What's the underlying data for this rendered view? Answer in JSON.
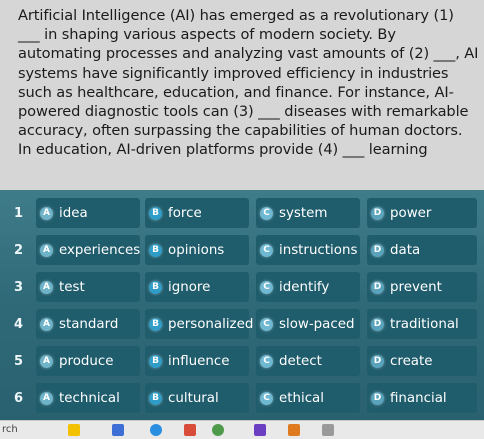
{
  "passage": {
    "lines": [
      "Artificial Intelligence (AI) has emerged as a revolutionary (1)",
      "___ in shaping various aspects of modern society. By",
      "automating processes and analyzing vast amounts of (2) ___, AI",
      "systems have significantly improved efficiency in industries",
      "such as healthcare, education, and finance. For instance, AI-",
      "powered diagnostic tools can (3) ___ diseases with remarkable",
      "accuracy, often surpassing the capabilities of human doctors.",
      "In education, AI-driven platforms provide (4) ___ learning"
    ]
  },
  "questions": [
    {
      "num": "1",
      "options": [
        {
          "letter": "A",
          "text": "idea"
        },
        {
          "letter": "B",
          "text": "force"
        },
        {
          "letter": "C",
          "text": "system"
        },
        {
          "letter": "D",
          "text": "power"
        }
      ]
    },
    {
      "num": "2",
      "options": [
        {
          "letter": "A",
          "text": "experiences"
        },
        {
          "letter": "B",
          "text": "opinions"
        },
        {
          "letter": "C",
          "text": "instructions"
        },
        {
          "letter": "D",
          "text": "data"
        }
      ]
    },
    {
      "num": "3",
      "options": [
        {
          "letter": "A",
          "text": "test"
        },
        {
          "letter": "B",
          "text": "ignore"
        },
        {
          "letter": "C",
          "text": "identify"
        },
        {
          "letter": "D",
          "text": "prevent"
        }
      ]
    },
    {
      "num": "4",
      "options": [
        {
          "letter": "A",
          "text": "standard"
        },
        {
          "letter": "B",
          "text": "personalized"
        },
        {
          "letter": "C",
          "text": "slow-paced"
        },
        {
          "letter": "D",
          "text": "traditional"
        }
      ]
    },
    {
      "num": "5",
      "options": [
        {
          "letter": "A",
          "text": "produce"
        },
        {
          "letter": "B",
          "text": "influence"
        },
        {
          "letter": "C",
          "text": "detect"
        },
        {
          "letter": "D",
          "text": "create"
        }
      ]
    },
    {
      "num": "6",
      "options": [
        {
          "letter": "A",
          "text": "technical"
        },
        {
          "letter": "B",
          "text": "cultural"
        },
        {
          "letter": "C",
          "text": "ethical"
        },
        {
          "letter": "D",
          "text": "financial"
        }
      ]
    }
  ],
  "taskbar": {
    "search_text": "rch",
    "icons": [
      "star-icon",
      "app-icon-1",
      "browser-icon",
      "app-icon-2",
      "app-icon-3",
      "app-icon-4",
      "app-icon-5",
      "app-icon-6"
    ],
    "icon_colors": [
      "#f2c200",
      "#3d6fd6",
      "#2a8fe0",
      "#d94c3a",
      "#4f9a4a",
      "#6b3fc2",
      "#e07a1f",
      "#9a9a9a"
    ]
  }
}
